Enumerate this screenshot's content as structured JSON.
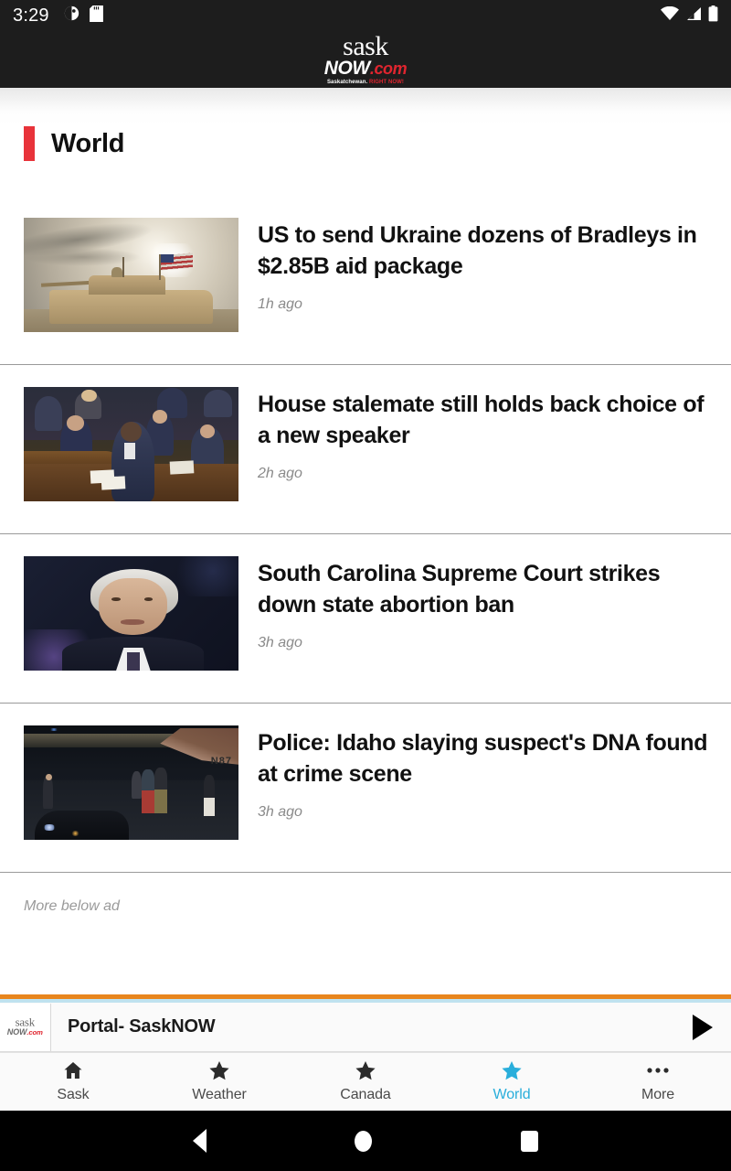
{
  "status_bar": {
    "time": "3:29",
    "left_icons": [
      "contrast-circle-icon",
      "sd-card-icon"
    ],
    "right_icons": [
      "wifi-icon",
      "cellular-signal-icon",
      "battery-icon"
    ]
  },
  "app_header": {
    "logo_line1": "sask",
    "logo_now": "NOW",
    "logo_com": ".com",
    "logo_tagline_1": "Saskatchewan. ",
    "logo_tagline_2": "RIGHT NOW!"
  },
  "section": {
    "title": "World",
    "accent_color": "#e8333a"
  },
  "articles": [
    {
      "title": "US to send Ukraine dozens of Bradleys in $2.85B aid package",
      "time": "1h ago",
      "thumb_alt": "Bradley fighting vehicle with US flag under bright sky"
    },
    {
      "title": "House stalemate still holds back choice of a new speaker",
      "time": "2h ago",
      "thumb_alt": "Lawmakers seated in the House chamber"
    },
    {
      "title": "South Carolina Supreme Court strikes down state abortion ban",
      "time": "3h ago",
      "thumb_alt": "Portrait of older man with white hair in dark suit"
    },
    {
      "title": "Police: Idaho slaying suspect's DNA found at crime scene",
      "time": "3h ago",
      "thumb_alt": "Night tarmac scene with plane and people walking"
    }
  ],
  "more_below_ad": "More below ad",
  "player": {
    "title": "Portal- SaskNOW",
    "play_icon": "play-icon",
    "accent_top_color": "#e8861e",
    "accent_sub_color": "#bfe2ef"
  },
  "bottom_nav": {
    "active_color": "#29aedb",
    "items": [
      {
        "label": "Sask",
        "icon": "home-icon",
        "active": false
      },
      {
        "label": "Weather",
        "icon": "star-icon",
        "active": false
      },
      {
        "label": "Canada",
        "icon": "star-icon",
        "active": false
      },
      {
        "label": "World",
        "icon": "star-icon",
        "active": true
      },
      {
        "label": "More",
        "icon": "more-dots-icon",
        "active": false
      }
    ]
  },
  "android_nav": {
    "back": "back-triangle-icon",
    "home": "home-circle-icon",
    "recents": "recents-square-icon"
  }
}
